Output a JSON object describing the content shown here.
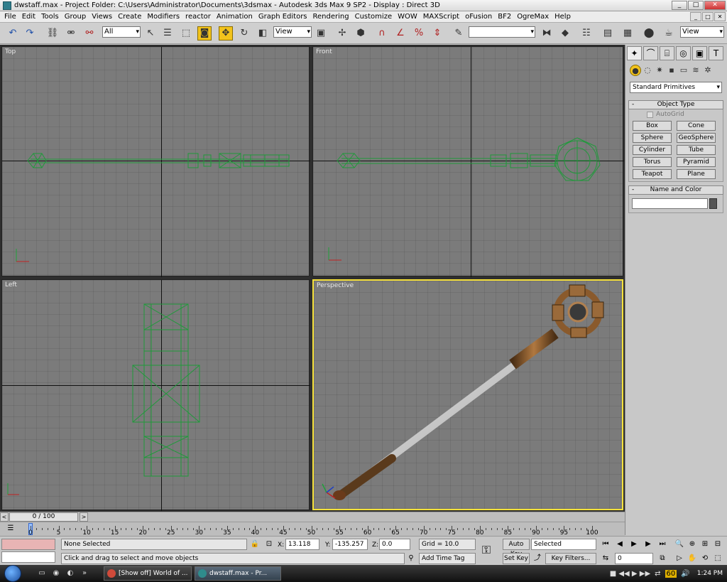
{
  "window": {
    "title": "dwstaff.max    - Project Folder: C:\\Users\\Administrator\\Documents\\3dsmax    - Autodesk 3ds Max 9 SP2    - Display : Direct 3D",
    "controls": [
      "_",
      "□",
      "✕"
    ]
  },
  "menu": {
    "items": [
      "File",
      "Edit",
      "Tools",
      "Group",
      "Views",
      "Create",
      "Modifiers",
      "reactor",
      "Animation",
      "Graph Editors",
      "Rendering",
      "Customize",
      "WOW",
      "MAXScript",
      "oFusion",
      "BF2",
      "OgreMax",
      "Help"
    ]
  },
  "toolbar": {
    "selection_filter": "All",
    "ref_coord": "View",
    "named_selection": "",
    "ref_coord_right": "View"
  },
  "viewports": {
    "top": {
      "label": "Top"
    },
    "front": {
      "label": "Front"
    },
    "left": {
      "label": "Left"
    },
    "perspective": {
      "label": "Perspective"
    }
  },
  "command_panel": {
    "category": "Standard Primitives",
    "object_type_header": "Object Type",
    "autogrid_label": "AutoGrid",
    "primitives": [
      "Box",
      "Cone",
      "Sphere",
      "GeoSphere",
      "Cylinder",
      "Tube",
      "Torus",
      "Pyramid",
      "Teapot",
      "Plane"
    ],
    "name_color_header": "Name and Color",
    "rollout_toggle": "-"
  },
  "timeline": {
    "slider_label": "0 / 100",
    "prev": "<",
    "next": ">",
    "tick_labels": [
      "0",
      "5",
      "10",
      "15",
      "20",
      "25",
      "30",
      "35",
      "40",
      "45",
      "50",
      "55",
      "60",
      "65",
      "70",
      "75",
      "80",
      "85",
      "90",
      "95",
      "100"
    ]
  },
  "status": {
    "selection": "None Selected",
    "prompt": "Click and drag to select and move objects",
    "x_label": "X:",
    "x_value": "13.118",
    "y_label": "Y:",
    "y_value": "-135.257",
    "z_label": "Z:",
    "z_value": "0.0",
    "grid": "Grid = 10.0",
    "add_time_tag": "Add Time Tag",
    "auto_key": "Auto Key",
    "set_key": "Set Key",
    "key_mode": "Selected",
    "key_filters": "Key Filters...",
    "frame_value": "0"
  },
  "taskbar": {
    "tasks": [
      "[Show off] World of ...",
      "dwstaff.max    - Pr..."
    ],
    "quicklaunch_more": "»",
    "tray_badge": "60",
    "clock": "1:24 PM"
  },
  "colors": {
    "wire": "#1f9a3a",
    "active_viewport": "#f7e23b",
    "highlight": "#f2c31c"
  }
}
